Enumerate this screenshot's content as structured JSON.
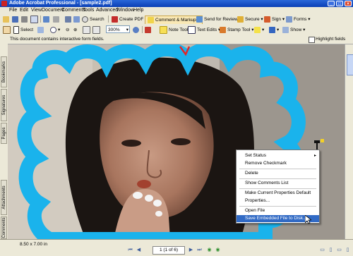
{
  "window": {
    "title": "Adobe Acrobat Professional - [sample2.pdf]"
  },
  "menubar": [
    "File",
    "Edit",
    "View",
    "Document",
    "Comments",
    "Tools",
    "Advanced",
    "Window",
    "Help"
  ],
  "toolbar1": {
    "search": "Search",
    "create_pdf": "Create PDF",
    "comment_markup": "Comment & Markup",
    "send_for_review": "Send for Review",
    "secure": "Secure",
    "sign": "Sign",
    "forms": "Forms"
  },
  "toolbar2": {
    "select": "Select",
    "zoom": "300%",
    "note_tool": "Note Tool",
    "text_edits": "Text Edits",
    "stamp_tool": "Stamp Tool",
    "show": "Show"
  },
  "message_bar": {
    "text": "This document contains interactive form fields.",
    "highlight_fields": "Highlight fields"
  },
  "nav_tabs": [
    "Bookmarks",
    "Signatures",
    "Pages",
    "Attachments",
    "Comments"
  ],
  "status_bar": {
    "page_size": "8.50 x 7.00 in",
    "page_indicator": "1 (1 of 6)"
  },
  "context_menu": {
    "items": [
      "Set Status",
      "Remove Checkmark",
      "Delete",
      "Show Comments List",
      "Make Current Properties Default",
      "Properties...",
      "Open File",
      "Save Embedded File to Disk..."
    ],
    "selected": "Save Embedded File to Disk..."
  },
  "colors": {
    "frame": "#1ab3ec",
    "title_bar": "#0a3fb5",
    "menu_highlight": "#316ac5"
  }
}
